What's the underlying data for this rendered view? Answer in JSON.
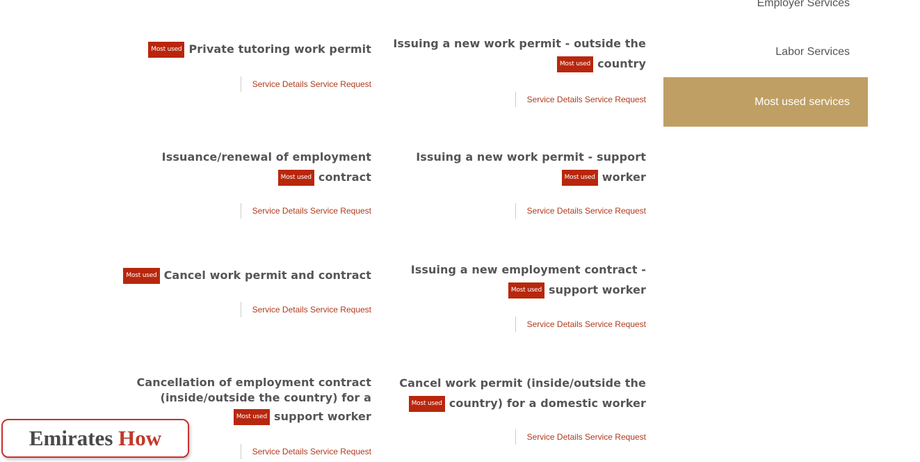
{
  "sidebar": {
    "items": [
      {
        "label": "Employer Services"
      },
      {
        "label": "Labor Services"
      },
      {
        "label": "Most used services"
      }
    ]
  },
  "badge_label": "Most used",
  "links": {
    "details": "Service Details",
    "request": "Service Request"
  },
  "cards": [
    {
      "title": "Issuing a new work permit - outside the",
      "title_end": "country"
    },
    {
      "title": "",
      "title_end": "Private tutoring work permit"
    },
    {
      "title": "Issuing a new work permit - support",
      "title_end": "worker"
    },
    {
      "title": "Issuance/renewal of employment",
      "title_end": "contract"
    },
    {
      "title": "Issuing a new employment contract -",
      "title_end": "support worker"
    },
    {
      "title": "",
      "title_end": "Cancel work permit and contract"
    },
    {
      "title": "Cancel work permit (inside/outside the",
      "title_end": "country) for a domestic worker"
    },
    {
      "title": "Cancellation of employment contract (inside/outside the country) for a",
      "title_end": "support worker"
    }
  ],
  "logo": {
    "word1": "Emirates",
    "word2": "How"
  },
  "colors": {
    "accent": "#bf9f64",
    "badge": "#b8270d",
    "link": "#b03a1c"
  }
}
